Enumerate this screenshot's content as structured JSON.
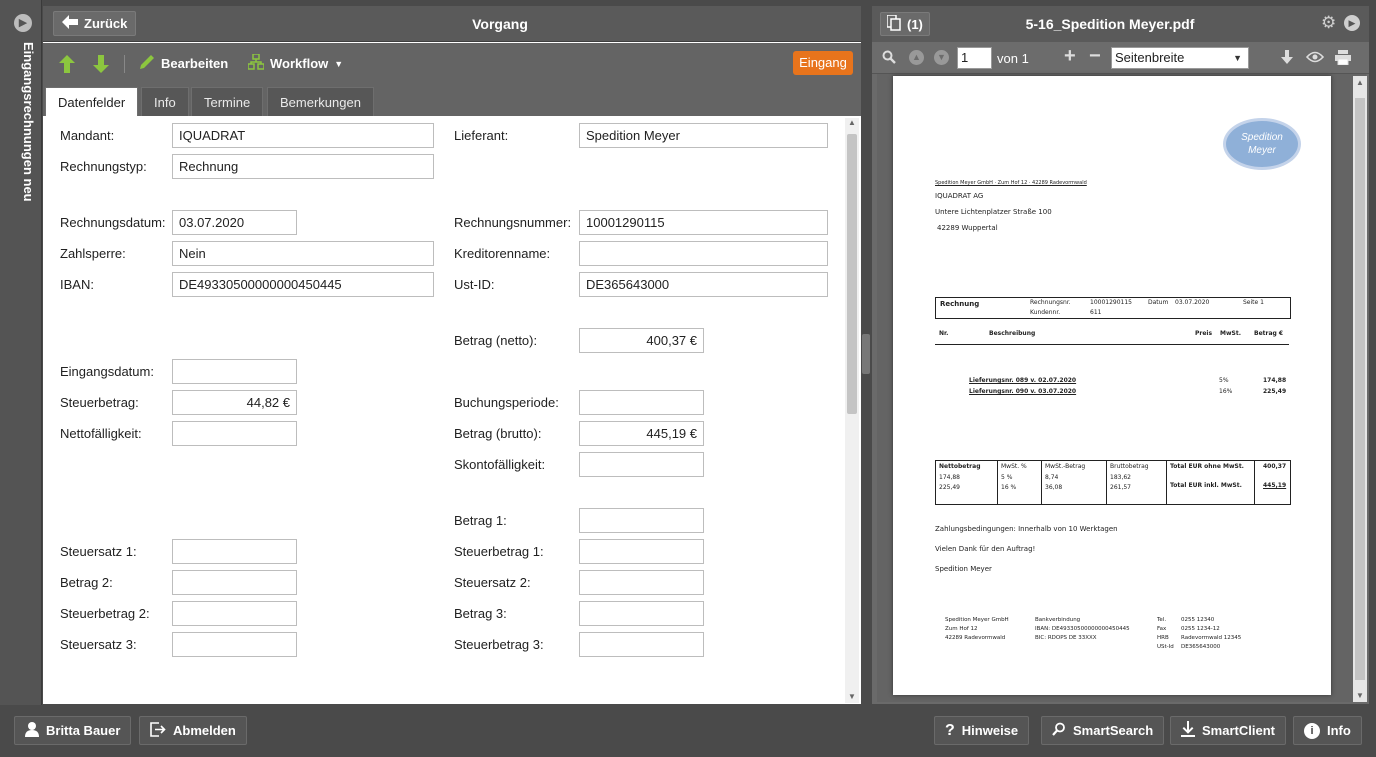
{
  "sidebar": {
    "label": "Eingangsrechnungen neu"
  },
  "left": {
    "back_label": "Zurück",
    "title": "Vorgang",
    "toolbar": {
      "edit": "Bearbeiten",
      "workflow": "Workflow"
    },
    "status": "Eingang",
    "tabs": [
      "Datenfelder",
      "Info",
      "Termine",
      "Bemerkungen"
    ]
  },
  "form": {
    "mandant": {
      "label": "Mandant:",
      "value": "IQUADRAT"
    },
    "rechnungstyp": {
      "label": "Rechnungstyp:",
      "value": "Rechnung"
    },
    "rechnungsdatum": {
      "label": "Rechnungsdatum:",
      "value": "03.07.2020"
    },
    "zahlsperre": {
      "label": "Zahlsperre:",
      "value": "Nein"
    },
    "iban": {
      "label": "IBAN:",
      "value": "DE49330500000000450445"
    },
    "eingangsdatum": {
      "label": "Eingangsdatum:",
      "value": ""
    },
    "steuerbetrag": {
      "label": "Steuerbetrag:",
      "value": "44,82 €"
    },
    "nettofaelligkeit": {
      "label": "Nettofälligkeit:",
      "value": ""
    },
    "steuersatz1": {
      "label": "Steuersatz 1:",
      "value": ""
    },
    "betrag2": {
      "label": "Betrag 2:",
      "value": ""
    },
    "steuerbetrag2": {
      "label": "Steuerbetrag 2:",
      "value": ""
    },
    "steuersatz3": {
      "label": "Steuersatz 3:",
      "value": ""
    },
    "lieferant": {
      "label": "Lieferant:",
      "value": "Spedition Meyer"
    },
    "rechnungsnummer": {
      "label": "Rechnungsnummer:",
      "value": "10001290115"
    },
    "kreditorenname": {
      "label": "Kreditorenname:",
      "value": ""
    },
    "ustid": {
      "label": "Ust-ID:",
      "value": "DE365643000"
    },
    "betrag_netto": {
      "label": "Betrag (netto):",
      "value": "400,37 €"
    },
    "buchungsperiode": {
      "label": "Buchungsperiode:",
      "value": ""
    },
    "betrag_brutto": {
      "label": "Betrag (brutto):",
      "value": "445,19 €"
    },
    "skontofaelligkeit": {
      "label": "Skontofälligkeit:",
      "value": ""
    },
    "betrag1": {
      "label": "Betrag 1:",
      "value": ""
    },
    "steuerbetrag1": {
      "label": "Steuerbetrag 1:",
      "value": ""
    },
    "steuersatz2": {
      "label": "Steuersatz 2:",
      "value": ""
    },
    "betrag3": {
      "label": "Betrag 3:",
      "value": ""
    },
    "steuerbetrag3": {
      "label": "Steuerbetrag 3:",
      "value": ""
    }
  },
  "right": {
    "attachments_label": "(1)",
    "title": "5-16_Spedition Meyer.pdf",
    "page_value": "1",
    "page_of": "von 1",
    "zoom": "Seitenbreite"
  },
  "pdf": {
    "logo_line1": "Spedition",
    "logo_line2": "Meyer",
    "sender_line": "Spedition Meyer GmbH · Zum Hof 12 · 42289 Radevormwald",
    "addr1": "IQUADRAT AG",
    "addr2": "Untere Lichtenplatzer Straße 100",
    "addr3": "42289 Wuppertal",
    "doc_type": "Rechnung",
    "rnr_label": "Rechnungsnr.",
    "rnr": "10001290115",
    "kdnr_label": "Kundennr.",
    "kdnr": "611",
    "datum_label": "Datum",
    "datum": "03.07.2020",
    "seite": "Seite 1",
    "col_nr": "Nr.",
    "col_desc": "Beschreibung",
    "col_preis": "Preis",
    "col_mwst": "MwSt.",
    "col_betrag": "Betrag €",
    "item1_desc": "Lieferungsnr. 089 v. 02.07.2020",
    "item1_mwst": "5%",
    "item1_betrag": "174,88",
    "item2_desc": "Lieferungsnr. 090 v. 03.07.2020",
    "item2_mwst": "16%",
    "item2_betrag": "225,49",
    "sum_h1": "Nettobetrag",
    "sum_h2": "MwSt. %",
    "sum_h3": "MwSt.-Betrag",
    "sum_h4": "Bruttobetrag",
    "sum_r1c1": "174,88",
    "sum_r1c2": "5 %",
    "sum_r1c3": "8,74",
    "sum_r1c4": "183,62",
    "sum_r2c1": "225,49",
    "sum_r2c2": "16 %",
    "sum_r2c3": "36,08",
    "sum_r2c4": "261,57",
    "total_netto_label": "Total EUR ohne MwSt.",
    "total_netto": "400,37",
    "total_brutto_label": "Total EUR inkl. MwSt.",
    "total_brutto": "445,19",
    "zahlung": "Zahlungsbedingungen: Innerhalb von 10 Werktagen",
    "dank": "Vielen Dank für den Auftrag!",
    "gruss": "Spedition Meyer",
    "f1a": "Spedition Meyer GmbH",
    "f1b": "Zum Hof 12",
    "f1c": "42289 Radevormwald",
    "f2a": "Bankverbindung",
    "f2b": "IBAN: DE49330500000000450445",
    "f2c": "BIC: RDOPS DE 33XXX",
    "f3a": "Tel.",
    "f3b": "Fax",
    "f3c": "HRB",
    "f3d": "USt-Id",
    "f4a": "0255 12340",
    "f4b": "0255 1234-12",
    "f4c": "Radevormwald 12345",
    "f4d": "DE365643000"
  },
  "footer": {
    "user": "Britta Bauer",
    "logout": "Abmelden",
    "hints": "Hinweise",
    "smartsearch": "SmartSearch",
    "smartclient": "SmartClient",
    "info": "Info"
  },
  "colors": {
    "accent_orange": "#e8741c",
    "arrow_green": "#8cc63f",
    "panel_dark": "#4a4a4a"
  }
}
